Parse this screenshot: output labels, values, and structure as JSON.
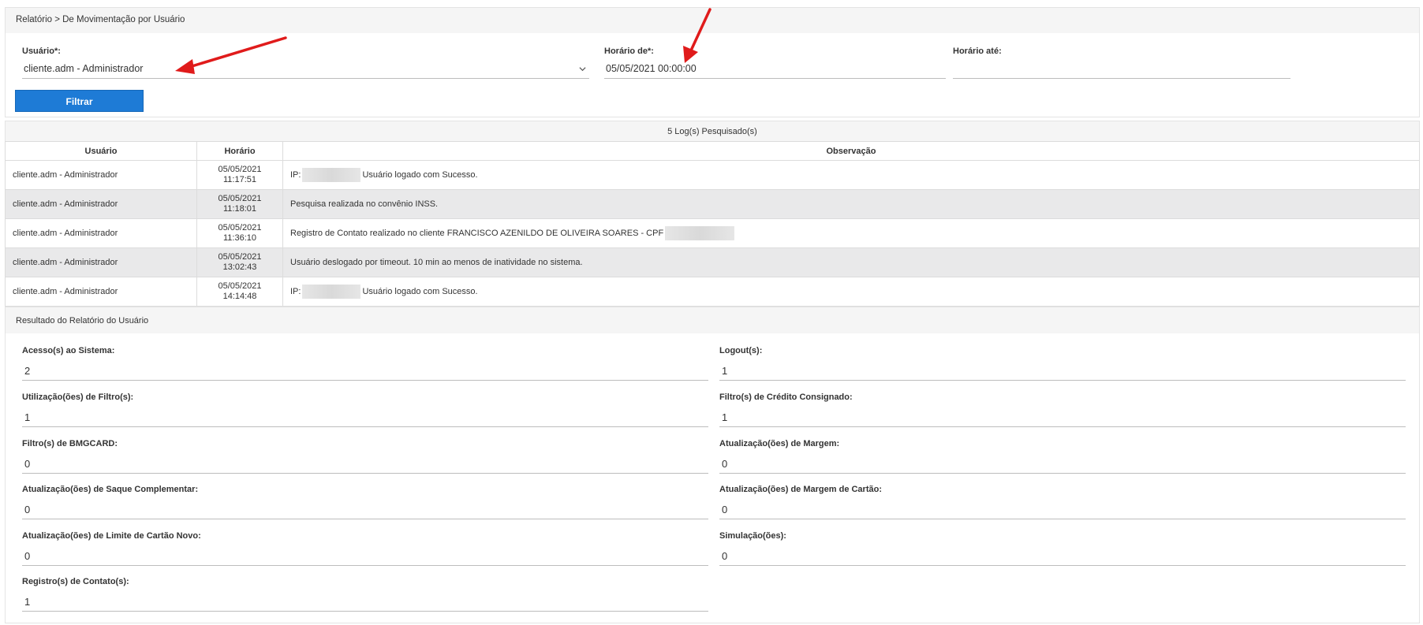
{
  "breadcrumb": "Relatório > De Movimentação por Usuário",
  "filters": {
    "usuario_label": "Usuário*:",
    "usuario_value": "cliente.adm - Administrador",
    "horario_de_label": "Horário de*:",
    "horario_de_value": "05/05/2021 00:00:00",
    "horario_ate_label": "Horário até:",
    "horario_ate_value": "",
    "filter_button": "Filtrar"
  },
  "log_count": "5 Log(s) Pesquisado(s)",
  "table": {
    "headers": [
      "Usuário",
      "Horário",
      "Observação"
    ],
    "rows": [
      {
        "usuario": "cliente.adm - Administrador",
        "date": "05/05/2021",
        "time": "11:17:51",
        "obs_prefix": "IP:",
        "obs": "Usuário logado com Sucesso."
      },
      {
        "usuario": "cliente.adm - Administrador",
        "date": "05/05/2021",
        "time": "11:18:01",
        "obs_prefix": "",
        "obs": "Pesquisa realizada no convênio INSS."
      },
      {
        "usuario": "cliente.adm - Administrador",
        "date": "05/05/2021",
        "time": "11:36:10",
        "obs_prefix": "",
        "obs": "Registro de Contato realizado no cliente FRANCISCO AZENILDO DE OLIVEIRA SOARES - CPF"
      },
      {
        "usuario": "cliente.adm - Administrador",
        "date": "05/05/2021",
        "time": "13:02:43",
        "obs_prefix": "",
        "obs": "Usuário deslogado por timeout. 10 min ao menos de inatividade no sistema."
      },
      {
        "usuario": "cliente.adm - Administrador",
        "date": "05/05/2021",
        "time": "14:14:48",
        "obs_prefix": "IP:",
        "obs": "Usuário logado com Sucesso."
      }
    ]
  },
  "results": {
    "title": "Resultado do Relatório do Usuário",
    "left": [
      {
        "label": "Acesso(s) ao Sistema:",
        "value": "2"
      },
      {
        "label": "Utilização(ões) de Filtro(s):",
        "value": "1"
      },
      {
        "label": "Filtro(s) de BMGCARD:",
        "value": "0"
      },
      {
        "label": "Atualização(ões) de Saque Complementar:",
        "value": "0"
      },
      {
        "label": "Atualização(ões) de Limite de Cartão Novo:",
        "value": "0"
      },
      {
        "label": "Registro(s) de Contato(s):",
        "value": "1"
      }
    ],
    "right": [
      {
        "label": "Logout(s):",
        "value": "1"
      },
      {
        "label": "Filtro(s) de Crédito Consignado:",
        "value": "1"
      },
      {
        "label": "Atualização(ões) de Margem:",
        "value": "0"
      },
      {
        "label": "Atualização(ões) de Margem de Cartão:",
        "value": "0"
      },
      {
        "label": "Simulação(ões):",
        "value": "0"
      }
    ]
  },
  "colors": {
    "primary_button": "#1e7bd6",
    "annotation_arrow": "#e01b1b",
    "row_alt": "#e9e9ea"
  }
}
